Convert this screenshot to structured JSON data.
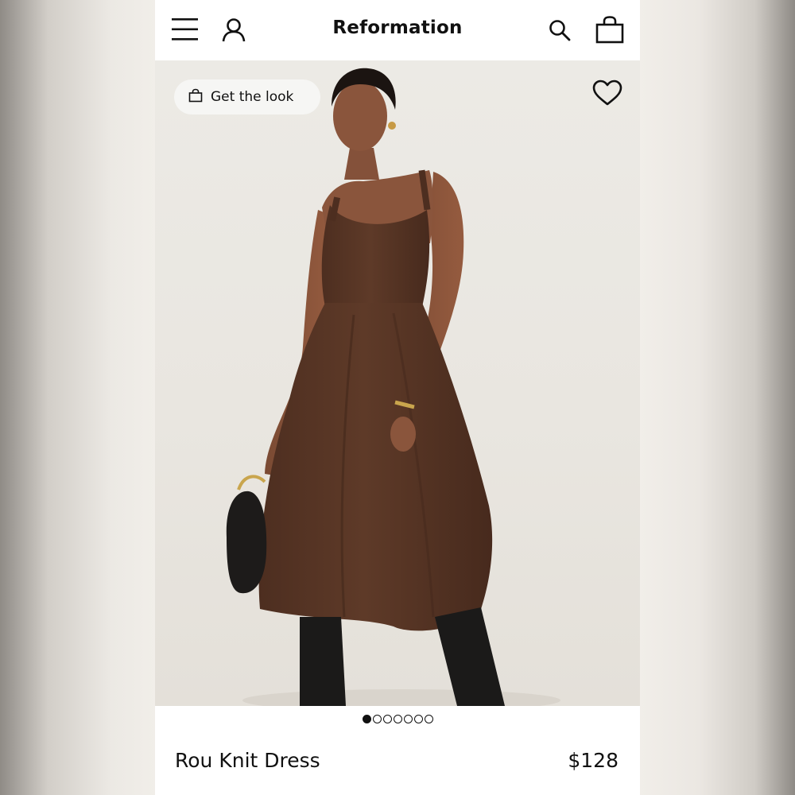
{
  "header": {
    "brand": "Reformation",
    "icons": [
      "menu-icon",
      "account-icon",
      "search-icon",
      "bag-icon"
    ]
  },
  "hero": {
    "get_the_look_label": "Get the look",
    "favorite_icon": "heart-icon",
    "image_description": null
  },
  "carousel": {
    "total_slides": 7,
    "active_index": 0
  },
  "product": {
    "name": "Rou Knit Dress",
    "price": "$128"
  },
  "colors": {
    "text": "#111111",
    "dress": "#5a3726",
    "backdrop": "#eceae5"
  }
}
